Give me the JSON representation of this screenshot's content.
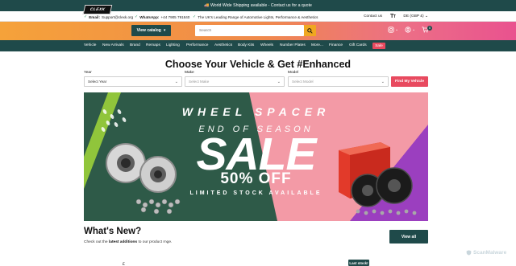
{
  "announcement": "🚚 World Wide Shipping available - Contact us for a quote",
  "infobar": {
    "email_label": "Email:",
    "email_value": "Support@clexk.org",
    "whatsapp_label": "WhatsApp:",
    "whatsapp_value": "+44 7905 791840",
    "tagline": "The UK's Leading Range of Automotive Lights, Performance & Aesthetics",
    "contact": "Contact us",
    "language_icon": "text-size-icon",
    "currency": "DE (GBP £)"
  },
  "header": {
    "logo_text": "CLEXK",
    "view_catalog": "View catalog",
    "search_placeholder": "Search",
    "cart_count": "0"
  },
  "nav": {
    "items": [
      "Vehicle",
      "New Arrivals",
      "Brand",
      "Remaps",
      "Lighting",
      "Performance",
      "Aesthetics",
      "Body Kits",
      "Wheels",
      "Number Plates",
      "More...",
      "Finance",
      "Gift Cards"
    ],
    "sale": "Sale"
  },
  "finder": {
    "title": "Choose Your Vehicle & Get #Enhanced",
    "year_label": "Year",
    "year_value": "Select Year",
    "make_label": "Make",
    "make_value": "Select Make",
    "model_label": "Model",
    "model_value": "Select Model",
    "button": "Find My Vehicle"
  },
  "banner": {
    "line1": "WHEEL SPACER",
    "line2": "END OF SEASON",
    "line3": "SALE",
    "line4": "50% OFF",
    "line5": "LIMITED STOCK AVAILABLE",
    "colors": {
      "green": "#2e5a48",
      "pink": "#f39aa6",
      "purple": "#9b3fbf",
      "lime": "#9bd03a"
    }
  },
  "whats_new": {
    "title": "What's New?",
    "sub_pre": "Check out the ",
    "sub_bold": "latest additions",
    "sub_post": " to our product rnge.",
    "view_all": "View all"
  },
  "badges": {
    "last_stock": "Last stock!"
  },
  "peek_label": "£",
  "watermark": "ScanMalware"
}
